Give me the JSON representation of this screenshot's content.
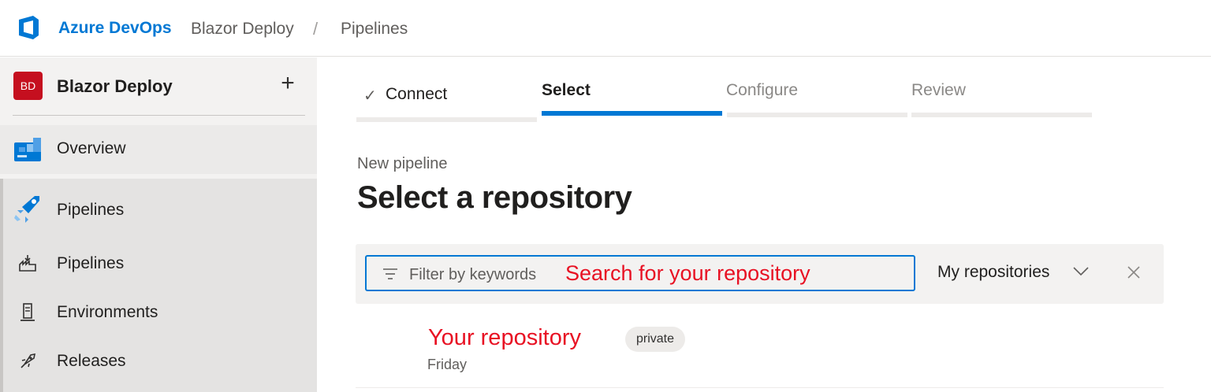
{
  "header": {
    "brand": "Azure DevOps",
    "breadcrumb": [
      "Blazor Deploy",
      "Pipelines"
    ],
    "separator": "/"
  },
  "sidebar": {
    "project": {
      "initials": "BD",
      "name": "Blazor Deploy",
      "add_label": "+"
    },
    "items": [
      {
        "label": "Overview",
        "icon": "overview-icon"
      },
      {
        "label": "Pipelines",
        "icon": "pipelines-hub-icon"
      }
    ],
    "subitems": [
      {
        "label": "Pipelines",
        "icon": "pipelines-icon"
      },
      {
        "label": "Environments",
        "icon": "environments-icon"
      },
      {
        "label": "Releases",
        "icon": "releases-icon"
      }
    ]
  },
  "wizard": {
    "steps": [
      {
        "label": "Connect",
        "state": "done",
        "check": "✓"
      },
      {
        "label": "Select",
        "state": "active"
      },
      {
        "label": "Configure",
        "state": "pending"
      },
      {
        "label": "Review",
        "state": "pending"
      }
    ]
  },
  "main": {
    "subtitle": "New pipeline",
    "title": "Select a repository",
    "filter": {
      "placeholder": "Filter by keywords",
      "annotation": "Search for your repository",
      "scope": "My repositories"
    },
    "repos": [
      {
        "name": "Your repository",
        "visibility": "private",
        "updated": "Friday"
      }
    ]
  },
  "colors": {
    "accent": "#0078d4",
    "annotation": "#e81123",
    "avatar": "#c50f1f"
  }
}
